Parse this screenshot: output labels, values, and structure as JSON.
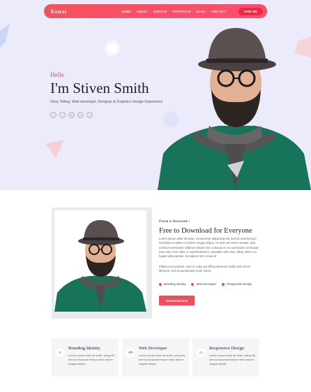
{
  "nav": {
    "logo": "Extrat",
    "links": [
      "HOME",
      "ABOUT",
      "SERVICE",
      "PORTFOLIO",
      "BLOG",
      "CONTACT"
    ],
    "cta": "HIRE ME"
  },
  "hero": {
    "hello": "Hello",
    "name": "I'm Stiven Smith",
    "tagline": "Story Telling, Web developer, Designer & Graphics Design Experience",
    "socials": [
      "f",
      "t",
      "in",
      "b",
      "v"
    ]
  },
  "about": {
    "subtitle": "Extrat is Awesome !",
    "title": "Free to Download for Everyone",
    "para1": "Lorem ipsum dolor sit amet, consectetur adipiscing elit, sed do eiusmod por incididunt ut labore et dolore magna aliqua. Ut enim ad minim veniam, quis nostrud exercitation ullamco laboris nisi ut aliquip ex ea commodo consequat. Duis aute irure dolor in reprehenderit in voluptate velit esse cillum dolore eu fugiat nulla pariatur. Excepteur sint occaecat",
    "para2": "Pitatat non proident, sunt in culpa qui officia deserunt mollit anim id est laborum. Sed ut perspiciatis unde omnis",
    "bullets": [
      "Branding Identity",
      "Web Developer",
      "Responsive Design"
    ],
    "button": "Download Now"
  },
  "services": [
    {
      "icon": "share-icon",
      "glyph": "<",
      "title": "Branding Identity",
      "text": "Lorem ipsum dolor sit amet, scing elit, sed do eiusmod tempor labor dolore magna aliqua."
    },
    {
      "icon": "code-icon",
      "glyph": "</>",
      "title": "Web Developer",
      "text": "Lorem ipsum dolor sit amet, scing elit, sed do eiusmod tempor labor dolore magna aliqua."
    },
    {
      "icon": "laptop-icon",
      "glyph": "▭",
      "title": "Responsive Design",
      "text": "Lorem ipsum dolor sit amet, scing elit, sed do eiusmod tempor labor dolore magna aliqua."
    }
  ],
  "colors": {
    "accent": "#f24b5a",
    "hero_bg": "#ecebfb",
    "dark_text": "#1d1d2b",
    "sweater": "#17735a"
  }
}
